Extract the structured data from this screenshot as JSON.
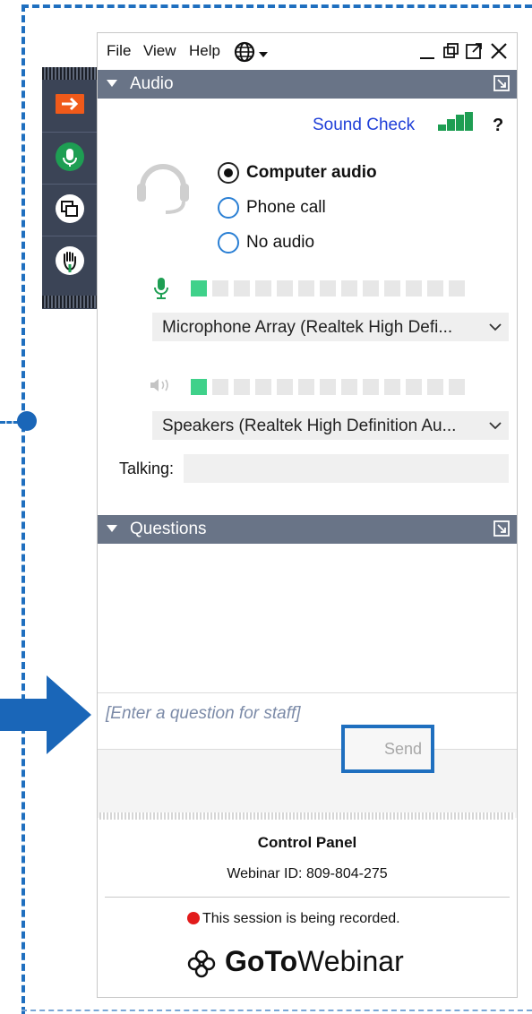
{
  "menu": {
    "file": "File",
    "view": "View",
    "help": "Help"
  },
  "audio": {
    "header": "Audio",
    "sound_check": "Sound Check",
    "help_mark": "?",
    "options": [
      {
        "label": "Computer audio",
        "selected": true
      },
      {
        "label": "Phone call",
        "selected": false
      },
      {
        "label": "No audio",
        "selected": false
      }
    ],
    "microphone": "Microphone Array (Realtek High Defi...",
    "speakers": "Speakers (Realtek High Definition Au...",
    "mic_level_segments": 1,
    "speaker_level_segments": 1,
    "total_segments": 13,
    "talking_label": "Talking:",
    "talking_value": ""
  },
  "questions": {
    "header": "Questions",
    "input_placeholder": "[Enter a question for staff]",
    "send_label": "Send"
  },
  "control_panel": {
    "title": "Control Panel",
    "webinar_id": "Webinar ID: 809-804-275",
    "recording_notice": "This session is being recorded.",
    "brand_goto": "GoTo",
    "brand_webinar": "Webinar"
  },
  "colors": {
    "accent": "#1f6fbf",
    "header_bg": "#697487",
    "toolbar_bg": "#3b4456",
    "level_on": "#3fd18a",
    "record": "#e21b1b",
    "link": "#1f3fd8"
  },
  "icons": {
    "toolbar": [
      "collapse-arrow-icon",
      "microphone-icon",
      "screen-share-icon",
      "raise-hand-icon"
    ],
    "window": [
      "globe-icon",
      "minimize-icon",
      "pop-out-icon",
      "restore-icon",
      "close-icon"
    ]
  }
}
